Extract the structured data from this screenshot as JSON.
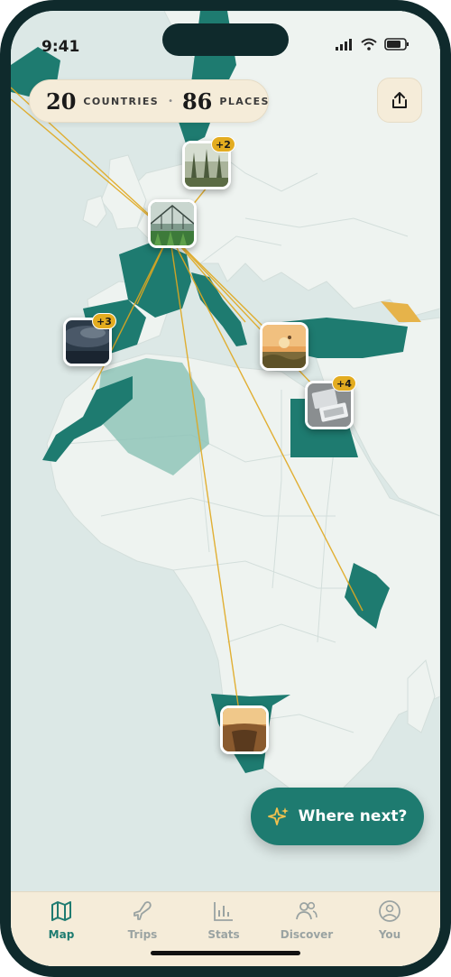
{
  "status": {
    "time": "9:41"
  },
  "stats": {
    "countries_count": "20",
    "countries_label": "COUNTRIES",
    "places_count": "86",
    "places_label": "PLACES"
  },
  "pins": [
    {
      "name": "forest",
      "badge": "+2"
    },
    {
      "name": "glasshouse",
      "badge": ""
    },
    {
      "name": "storm",
      "badge": "+3"
    },
    {
      "name": "balloons",
      "badge": ""
    },
    {
      "name": "desk",
      "badge": "+4"
    },
    {
      "name": "canyon",
      "badge": ""
    }
  ],
  "cta": {
    "label": "Where next?"
  },
  "tabs": [
    {
      "label": "Map",
      "icon": "map-icon",
      "active": true
    },
    {
      "label": "Trips",
      "icon": "plane-icon",
      "active": false
    },
    {
      "label": "Stats",
      "icon": "bar-chart-icon",
      "active": false
    },
    {
      "label": "Discover",
      "icon": "users-icon",
      "active": false
    },
    {
      "label": "You",
      "icon": "user-circle-icon",
      "active": false
    }
  ],
  "colors": {
    "visited": "#1e7b70",
    "visited_light": "#8fc4b8",
    "land": "#eef3f0",
    "sea": "#dce8e6",
    "accent": "#e3ac20",
    "tabbar": "#f5ecd9"
  }
}
